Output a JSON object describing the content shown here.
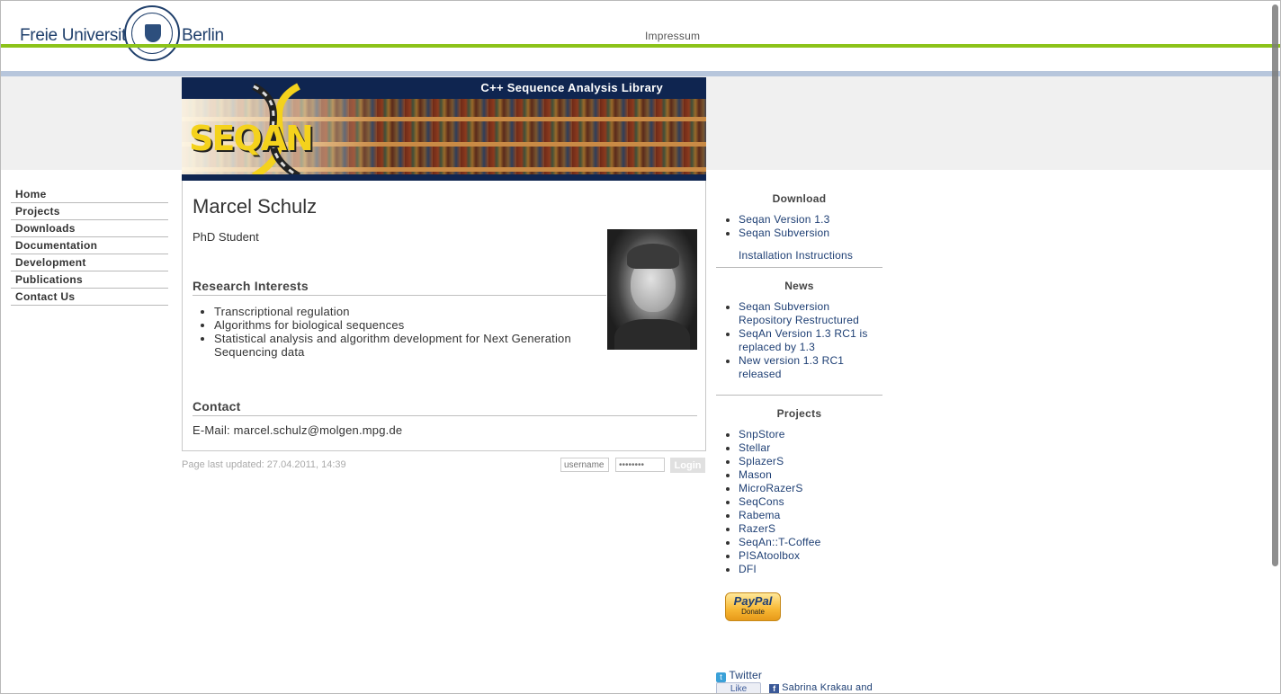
{
  "header": {
    "university_left": "Freie Universität",
    "university_right": "Berlin",
    "impressum_label": "Impressum"
  },
  "banner": {
    "title": "C++ Sequence Analysis Library",
    "logo_text": "SEQAN"
  },
  "nav": {
    "items": [
      {
        "label": "Home"
      },
      {
        "label": "Projects"
      },
      {
        "label": "Downloads"
      },
      {
        "label": "Documentation"
      },
      {
        "label": "Development"
      },
      {
        "label": "Publications"
      },
      {
        "label": "Contact Us"
      }
    ]
  },
  "profile": {
    "name": "Marcel Schulz",
    "role": "PhD Student",
    "research_heading": "Research Interests",
    "interests": [
      "Transcriptional regulation",
      "Algorithms for biological sequences",
      "Statistical analysis and algorithm development for Next Generation Sequencing data"
    ],
    "contact_heading": "Contact",
    "email_line": "E-Mail: marcel.schulz@molgen.mpg.de"
  },
  "footer": {
    "last_updated": "Page last updated: 27.04.2011, 14:39",
    "username_placeholder": "username",
    "password_placeholder": "••••••••",
    "login_label": "Login"
  },
  "sidebar": {
    "download_heading": "Download",
    "downloads": [
      "Seqan Version 1.3",
      "Seqan Subversion"
    ],
    "install_link": "Installation Instructions",
    "news_heading": "News",
    "news": [
      "Seqan Subversion Repository Restructured",
      "SeqAn Version 1.3 RC1 is replaced by 1.3",
      "New version 1.3 RC1 released"
    ],
    "projects_heading": "Projects",
    "projects": [
      "SnpStore",
      "Stellar",
      "SplazerS",
      "Mason",
      "MicroRazerS",
      "SeqCons",
      "Rabema",
      "RazerS",
      "SeqAn::T-Coffee",
      "PISAtoolbox",
      "DFI"
    ],
    "paypal_brand": "PayPal",
    "paypal_action": "Donate",
    "twitter_label": "Twitter",
    "like_label": "Like",
    "fb_text": "Sabrina Krakau and"
  },
  "colors": {
    "accent_green": "#8cc31a",
    "header_blue": "#b7c6dc",
    "banner_navy": "#0f2550",
    "link_blue": "#1e3f74"
  }
}
